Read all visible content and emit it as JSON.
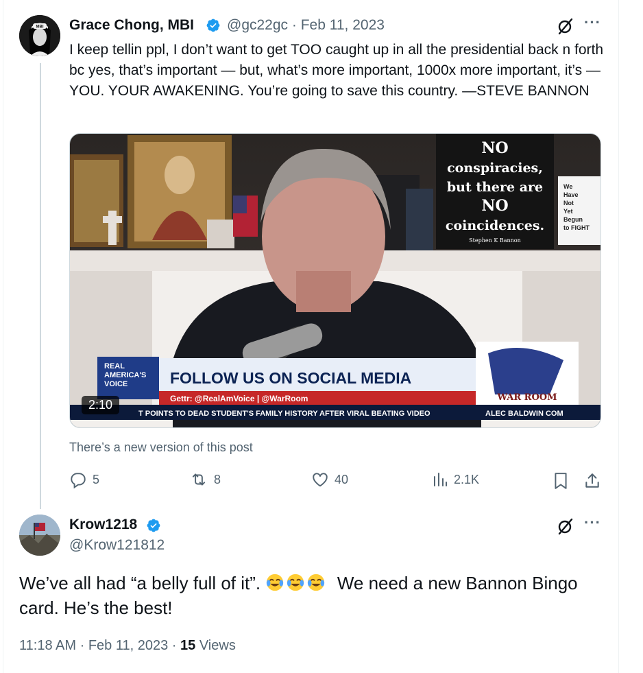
{
  "tweet": {
    "author_name": "Grace Chong, MBI",
    "handle": "@gc22gc",
    "separator": "·",
    "date": "Feb 11, 2023",
    "avatar_label": "MBI",
    "text": "I keep tellin ppl, I don’t want to get TOO caught up in all the presidential back n forth bc yes, that’s important — but, what’s more important, 1000x more important, it’s — YOU. YOUR AWAKENING. You’re going to save this country. —STEVE BANNON",
    "video": {
      "duration": "2:10",
      "sign_lines": [
        "NO",
        "conspiracies,",
        "but there are",
        "NO",
        "coincidences."
      ],
      "sign_signature": "Stephen K Bannon",
      "side_sign": [
        "We",
        "Have",
        "Not",
        "Yet",
        "Begun",
        "to FIGHT"
      ],
      "network_logo": [
        "REAL",
        "AMERICA'S",
        "VOICE"
      ],
      "banner_title": "FOLLOW US ON SOCIAL MEDIA",
      "banner_sub": "Gettr: @RealAmVoice | @WarRoom",
      "ticker": "T POINTS TO DEAD STUDENT'S FAMILY HISTORY AFTER VIRAL BEATING VIDEO",
      "ticker_right": "ALEC BALDWIN COM",
      "show_logo": "WAR ROOM"
    },
    "new_version_notice": "There’s a new version of this post",
    "actions": {
      "replies": "5",
      "reposts": "8",
      "likes": "40",
      "views": "2.1K"
    }
  },
  "reply": {
    "author_name": "Krow1218",
    "handle": "@Krow121812",
    "text_before_emoji": "We’ve all had “a belly full of it”.",
    "text_after_emoji": "We need a new Bannon Bingo card. He’s the best!",
    "emoji_count": 3,
    "time": "11:18 AM",
    "separator": "·",
    "date": "Feb 11, 2023",
    "views_count": "15",
    "views_label": "Views"
  },
  "colors": {
    "text": "#0f1419",
    "muted": "#536471",
    "verified": "#1d9bf0",
    "border": "#cfd9de"
  }
}
